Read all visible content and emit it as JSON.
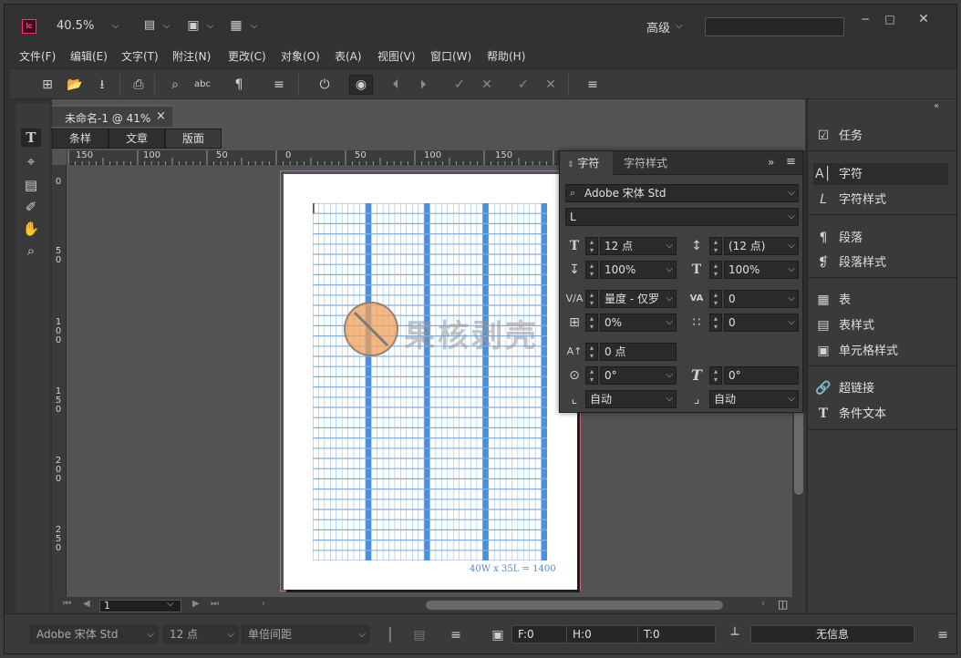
{
  "titlebar": {
    "app_logo": "Ic",
    "zoom": "40.5%",
    "workspace": "高级",
    "search_value": ""
  },
  "menu": [
    "文件(F)",
    "编辑(E)",
    "文字(T)",
    "附注(N)",
    "更改(C)",
    "对象(O)",
    "表(A)",
    "视图(V)",
    "窗口(W)",
    "帮助(H)"
  ],
  "document": {
    "tab_title": "未命名-1 @ 41%",
    "tab_close": "×",
    "view_tabs": [
      "条样",
      "文章",
      "版面"
    ],
    "h_ruler_labels": [
      "150",
      "100",
      "50",
      "0",
      "50",
      "100",
      "150"
    ],
    "v_ruler_labels": [
      "0",
      "5 0",
      "1 0 0",
      "1 5 0",
      "2 0 0",
      "2 5 0"
    ],
    "grid_caption": "40W x 35L = 1400",
    "watermark": "果核剥壳",
    "page_number": "1"
  },
  "char_panel": {
    "tab_active": "字符",
    "tab_other": "字符样式",
    "font_family": "Adobe 宋体 Std",
    "font_style": "L",
    "font_size": "12 点",
    "leading": "(12 点)",
    "vertical_scale": "100%",
    "horizontal_scale": "100%",
    "kerning": "量度 - 仅罗",
    "tracking": "0",
    "tsume": "0%",
    "grid_spacing": "0",
    "baseline_shift": "0 点",
    "rotation": "0°",
    "skew": "0°",
    "aki_before": "自动",
    "aki_after": "自动"
  },
  "right_panel": {
    "items": [
      {
        "label": "任务",
        "icon": "assignment-icon"
      },
      {
        "label": "字符",
        "icon": "character-icon"
      },
      {
        "label": "字符样式",
        "icon": "character-style-icon"
      },
      {
        "label": "段落",
        "icon": "paragraph-icon"
      },
      {
        "label": "段落样式",
        "icon": "paragraph-style-icon"
      },
      {
        "label": "表",
        "icon": "table-icon"
      },
      {
        "label": "表样式",
        "icon": "table-style-icon"
      },
      {
        "label": "单元格样式",
        "icon": "cell-style-icon"
      },
      {
        "label": "超链接",
        "icon": "hyperlink-icon"
      },
      {
        "label": "条件文本",
        "icon": "conditional-text-icon"
      }
    ]
  },
  "statusbar": {
    "font": "Adobe 宋体 Std",
    "size": "12 点",
    "spacing": "单倍间距",
    "f_value": "F:0",
    "h_value": "H:0",
    "t_value": "T:0",
    "info": "无信息"
  },
  "colors": {
    "accent_pink": "#ff3366",
    "grid_blue": "#4a8fe0",
    "grid_line": "#7fb0e8"
  }
}
